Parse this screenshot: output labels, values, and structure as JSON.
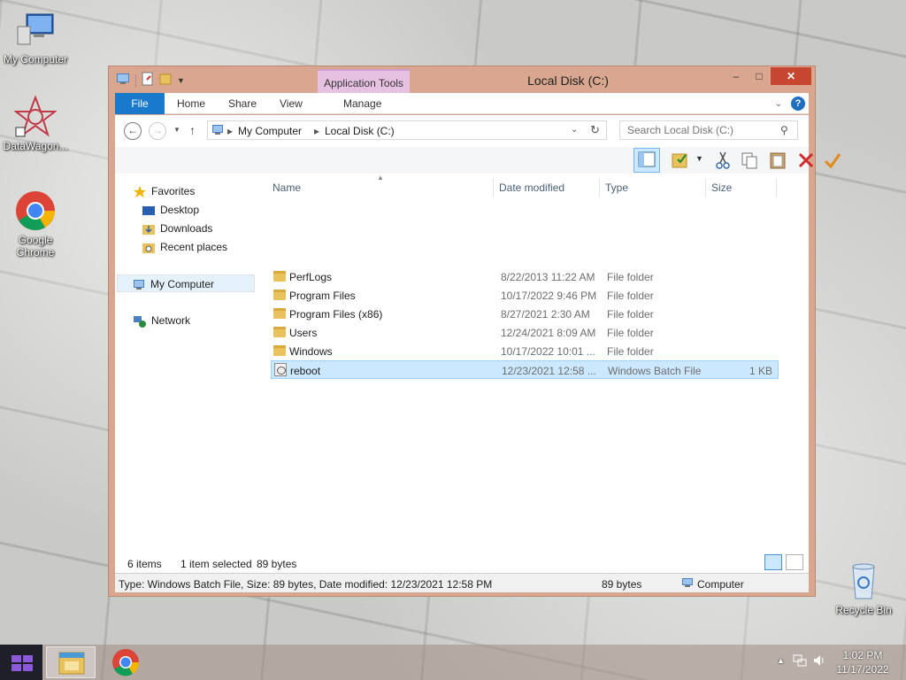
{
  "desktop": {
    "icons": [
      {
        "label": "My Computer"
      },
      {
        "label": "DataWagon..."
      },
      {
        "label": "Google Chrome"
      },
      {
        "label": "Recycle Bin"
      }
    ]
  },
  "window": {
    "title": "Local Disk (C:)",
    "context_tab": "Application Tools",
    "minimize": "–",
    "maximize": "□",
    "close": "✕"
  },
  "ribbon": {
    "tabs": [
      "File",
      "Home",
      "Share",
      "View",
      "Manage"
    ]
  },
  "navbar": {
    "back": "←",
    "forward": "→",
    "up": "↑",
    "crumbs": [
      "My Computer",
      "Local Disk (C:)"
    ],
    "search_placeholder": "Search Local Disk (C:)"
  },
  "navpane": {
    "favorites": "Favorites",
    "desktop": "Desktop",
    "downloads": "Downloads",
    "recent": "Recent places",
    "computer": "My Computer",
    "network": "Network"
  },
  "columns": [
    "Name",
    "Date modified",
    "Type",
    "Size"
  ],
  "files": [
    {
      "name": "PerfLogs",
      "date": "8/22/2013 11:22 AM",
      "type": "File folder",
      "size": "",
      "kind": "folder"
    },
    {
      "name": "Program Files",
      "date": "10/17/2022 9:46 PM",
      "type": "File folder",
      "size": "",
      "kind": "folder"
    },
    {
      "name": "Program Files (x86)",
      "date": "8/27/2021 2:30 AM",
      "type": "File folder",
      "size": "",
      "kind": "folder"
    },
    {
      "name": "Users",
      "date": "12/24/2021 8:09 AM",
      "type": "File folder",
      "size": "",
      "kind": "folder"
    },
    {
      "name": "Windows",
      "date": "10/17/2022 10:01 ...",
      "type": "File folder",
      "size": "",
      "kind": "folder"
    },
    {
      "name": "reboot",
      "date": "12/23/2021 12:58 ...",
      "type": "Windows Batch File",
      "size": "1 KB",
      "kind": "bat"
    }
  ],
  "status": {
    "items": "6 items",
    "selected": "1 item selected",
    "bytes": "89 bytes"
  },
  "infobar": {
    "details": "Type: Windows Batch File, Size: 89 bytes, Date modified: 12/23/2021 12:58 PM",
    "size": "89 bytes",
    "location": "Computer"
  },
  "taskbar": {
    "time": "1:02 PM",
    "date": "11/17/2022"
  },
  "colors": {
    "accent": "#1979ca",
    "window_frame": "#d9a78f",
    "selection": "#cce8ff"
  }
}
